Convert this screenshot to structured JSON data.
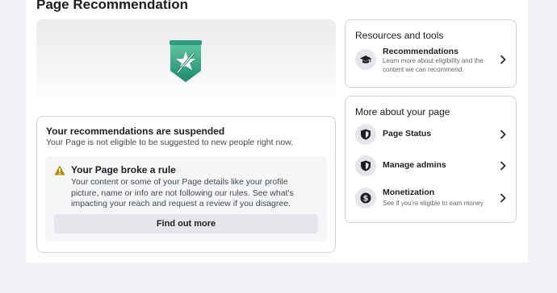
{
  "page_title": "Page Recommendation",
  "suspension": {
    "title": "Your recommendations are suspended",
    "subtitle": "Your Page is not eligible to be suggested to new people right now.",
    "rule_title": "Your Page broke a rule",
    "rule_body": "Your content or some of your Page details like your profile picture, name or info are not following our rules. See what's impacting your reach and request a review if you disagree.",
    "button_label": "Find out more"
  },
  "resources": {
    "title": "Resources and tools",
    "items": [
      {
        "title": "Recommendations",
        "subtitle": "Learn more about eligibility and the content we can recommend.",
        "icon": "graduation-cap-icon"
      }
    ]
  },
  "more_about": {
    "title": "More about your page",
    "items": [
      {
        "title": "Page Status",
        "subtitle": "",
        "icon": "shield-icon"
      },
      {
        "title": "Manage admins",
        "subtitle": "",
        "icon": "shield-icon"
      },
      {
        "title": "Monetization",
        "subtitle": "See if you're eligible to earn money",
        "icon": "dollar-coin-icon"
      }
    ]
  },
  "colors": {
    "badge_green": "#3fae8c",
    "badge_dark": "#1d7f67",
    "warning": "#b98b00",
    "button_bg": "#e4e6eb"
  }
}
